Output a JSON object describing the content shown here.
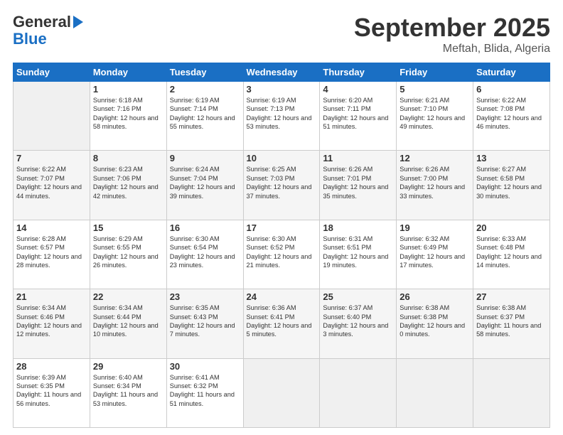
{
  "header": {
    "logo_line1": "General",
    "logo_line2": "Blue",
    "month": "September 2025",
    "location": "Meftah, Blida, Algeria"
  },
  "days_of_week": [
    "Sunday",
    "Monday",
    "Tuesday",
    "Wednesday",
    "Thursday",
    "Friday",
    "Saturday"
  ],
  "weeks": [
    [
      {
        "day": "",
        "sunrise": "",
        "sunset": "",
        "daylight": ""
      },
      {
        "day": "1",
        "sunrise": "Sunrise: 6:18 AM",
        "sunset": "Sunset: 7:16 PM",
        "daylight": "Daylight: 12 hours and 58 minutes."
      },
      {
        "day": "2",
        "sunrise": "Sunrise: 6:19 AM",
        "sunset": "Sunset: 7:14 PM",
        "daylight": "Daylight: 12 hours and 55 minutes."
      },
      {
        "day": "3",
        "sunrise": "Sunrise: 6:19 AM",
        "sunset": "Sunset: 7:13 PM",
        "daylight": "Daylight: 12 hours and 53 minutes."
      },
      {
        "day": "4",
        "sunrise": "Sunrise: 6:20 AM",
        "sunset": "Sunset: 7:11 PM",
        "daylight": "Daylight: 12 hours and 51 minutes."
      },
      {
        "day": "5",
        "sunrise": "Sunrise: 6:21 AM",
        "sunset": "Sunset: 7:10 PM",
        "daylight": "Daylight: 12 hours and 49 minutes."
      },
      {
        "day": "6",
        "sunrise": "Sunrise: 6:22 AM",
        "sunset": "Sunset: 7:08 PM",
        "daylight": "Daylight: 12 hours and 46 minutes."
      }
    ],
    [
      {
        "day": "7",
        "sunrise": "Sunrise: 6:22 AM",
        "sunset": "Sunset: 7:07 PM",
        "daylight": "Daylight: 12 hours and 44 minutes."
      },
      {
        "day": "8",
        "sunrise": "Sunrise: 6:23 AM",
        "sunset": "Sunset: 7:06 PM",
        "daylight": "Daylight: 12 hours and 42 minutes."
      },
      {
        "day": "9",
        "sunrise": "Sunrise: 6:24 AM",
        "sunset": "Sunset: 7:04 PM",
        "daylight": "Daylight: 12 hours and 39 minutes."
      },
      {
        "day": "10",
        "sunrise": "Sunrise: 6:25 AM",
        "sunset": "Sunset: 7:03 PM",
        "daylight": "Daylight: 12 hours and 37 minutes."
      },
      {
        "day": "11",
        "sunrise": "Sunrise: 6:26 AM",
        "sunset": "Sunset: 7:01 PM",
        "daylight": "Daylight: 12 hours and 35 minutes."
      },
      {
        "day": "12",
        "sunrise": "Sunrise: 6:26 AM",
        "sunset": "Sunset: 7:00 PM",
        "daylight": "Daylight: 12 hours and 33 minutes."
      },
      {
        "day": "13",
        "sunrise": "Sunrise: 6:27 AM",
        "sunset": "Sunset: 6:58 PM",
        "daylight": "Daylight: 12 hours and 30 minutes."
      }
    ],
    [
      {
        "day": "14",
        "sunrise": "Sunrise: 6:28 AM",
        "sunset": "Sunset: 6:57 PM",
        "daylight": "Daylight: 12 hours and 28 minutes."
      },
      {
        "day": "15",
        "sunrise": "Sunrise: 6:29 AM",
        "sunset": "Sunset: 6:55 PM",
        "daylight": "Daylight: 12 hours and 26 minutes."
      },
      {
        "day": "16",
        "sunrise": "Sunrise: 6:30 AM",
        "sunset": "Sunset: 6:54 PM",
        "daylight": "Daylight: 12 hours and 23 minutes."
      },
      {
        "day": "17",
        "sunrise": "Sunrise: 6:30 AM",
        "sunset": "Sunset: 6:52 PM",
        "daylight": "Daylight: 12 hours and 21 minutes."
      },
      {
        "day": "18",
        "sunrise": "Sunrise: 6:31 AM",
        "sunset": "Sunset: 6:51 PM",
        "daylight": "Daylight: 12 hours and 19 minutes."
      },
      {
        "day": "19",
        "sunrise": "Sunrise: 6:32 AM",
        "sunset": "Sunset: 6:49 PM",
        "daylight": "Daylight: 12 hours and 17 minutes."
      },
      {
        "day": "20",
        "sunrise": "Sunrise: 6:33 AM",
        "sunset": "Sunset: 6:48 PM",
        "daylight": "Daylight: 12 hours and 14 minutes."
      }
    ],
    [
      {
        "day": "21",
        "sunrise": "Sunrise: 6:34 AM",
        "sunset": "Sunset: 6:46 PM",
        "daylight": "Daylight: 12 hours and 12 minutes."
      },
      {
        "day": "22",
        "sunrise": "Sunrise: 6:34 AM",
        "sunset": "Sunset: 6:44 PM",
        "daylight": "Daylight: 12 hours and 10 minutes."
      },
      {
        "day": "23",
        "sunrise": "Sunrise: 6:35 AM",
        "sunset": "Sunset: 6:43 PM",
        "daylight": "Daylight: 12 hours and 7 minutes."
      },
      {
        "day": "24",
        "sunrise": "Sunrise: 6:36 AM",
        "sunset": "Sunset: 6:41 PM",
        "daylight": "Daylight: 12 hours and 5 minutes."
      },
      {
        "day": "25",
        "sunrise": "Sunrise: 6:37 AM",
        "sunset": "Sunset: 6:40 PM",
        "daylight": "Daylight: 12 hours and 3 minutes."
      },
      {
        "day": "26",
        "sunrise": "Sunrise: 6:38 AM",
        "sunset": "Sunset: 6:38 PM",
        "daylight": "Daylight: 12 hours and 0 minutes."
      },
      {
        "day": "27",
        "sunrise": "Sunrise: 6:38 AM",
        "sunset": "Sunset: 6:37 PM",
        "daylight": "Daylight: 11 hours and 58 minutes."
      }
    ],
    [
      {
        "day": "28",
        "sunrise": "Sunrise: 6:39 AM",
        "sunset": "Sunset: 6:35 PM",
        "daylight": "Daylight: 11 hours and 56 minutes."
      },
      {
        "day": "29",
        "sunrise": "Sunrise: 6:40 AM",
        "sunset": "Sunset: 6:34 PM",
        "daylight": "Daylight: 11 hours and 53 minutes."
      },
      {
        "day": "30",
        "sunrise": "Sunrise: 6:41 AM",
        "sunset": "Sunset: 6:32 PM",
        "daylight": "Daylight: 11 hours and 51 minutes."
      },
      {
        "day": "",
        "sunrise": "",
        "sunset": "",
        "daylight": ""
      },
      {
        "day": "",
        "sunrise": "",
        "sunset": "",
        "daylight": ""
      },
      {
        "day": "",
        "sunrise": "",
        "sunset": "",
        "daylight": ""
      },
      {
        "day": "",
        "sunrise": "",
        "sunset": "",
        "daylight": ""
      }
    ]
  ]
}
